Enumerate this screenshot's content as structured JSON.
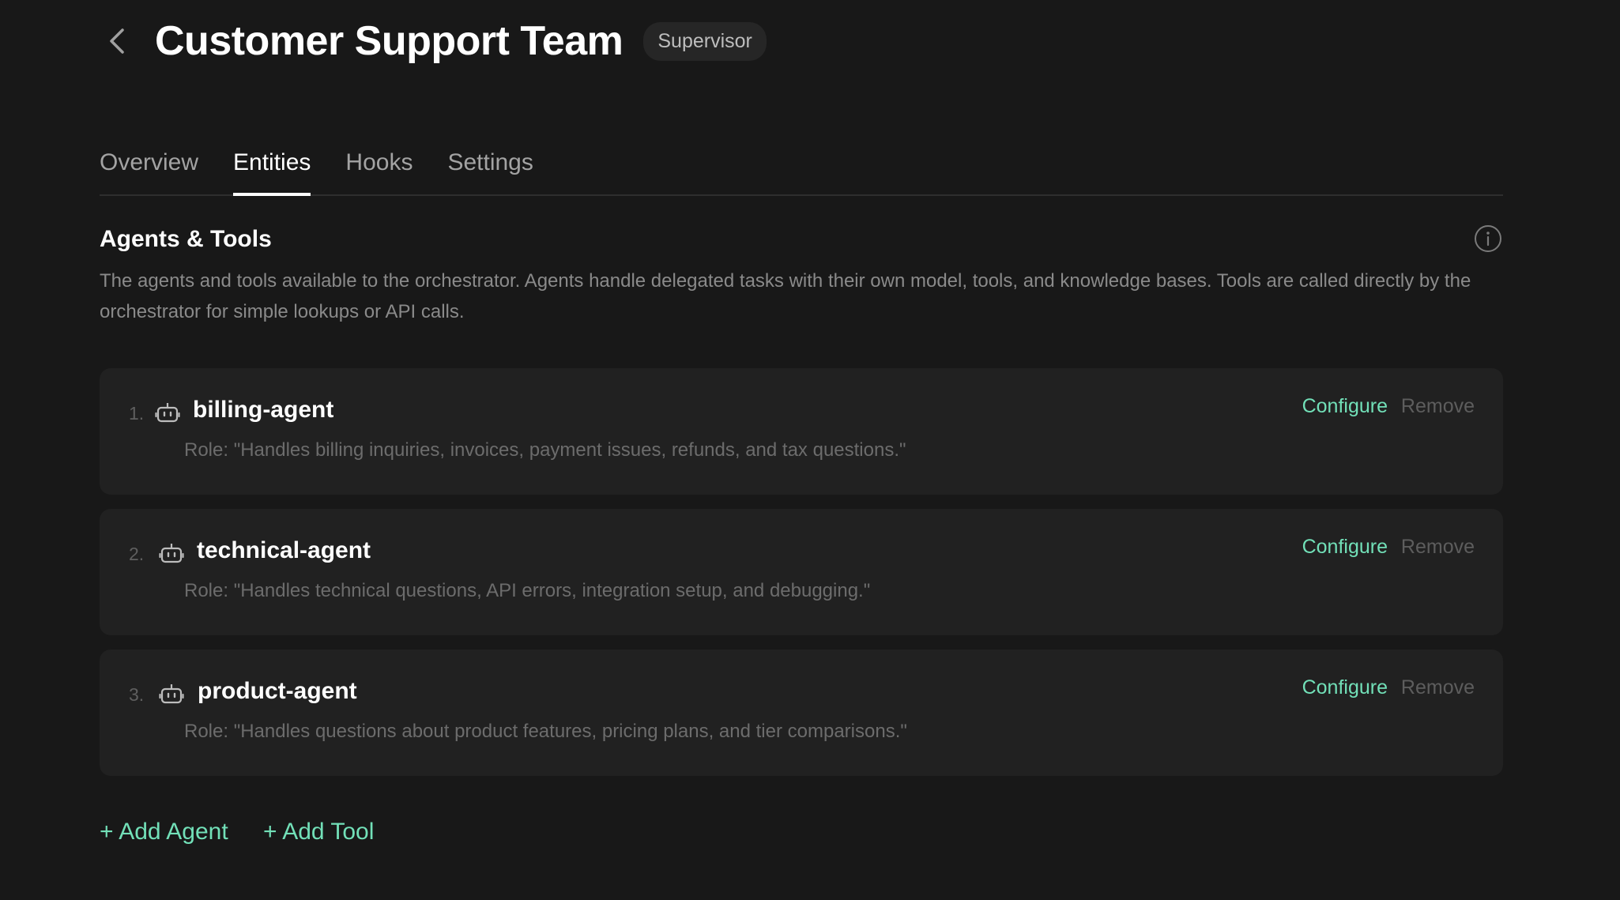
{
  "header": {
    "title": "Customer Support Team",
    "badge": "Supervisor"
  },
  "tabs": [
    {
      "label": "Overview",
      "active": false
    },
    {
      "label": "Entities",
      "active": true
    },
    {
      "label": "Hooks",
      "active": false
    },
    {
      "label": "Settings",
      "active": false
    }
  ],
  "section": {
    "title": "Agents & Tools",
    "description": "The agents and tools available to the orchestrator. Agents handle delegated tasks with their own model, tools, and knowledge bases. Tools are called directly by the orchestrator for simple lookups or API calls."
  },
  "agents": [
    {
      "number": "1.",
      "icon": "robot-icon",
      "name": "billing-agent",
      "role": "Role: \"Handles billing inquiries, invoices, payment issues, refunds, and tax questions.\"",
      "configure_label": "Configure",
      "remove_label": "Remove"
    },
    {
      "number": "2.",
      "icon": "robot-icon",
      "name": "technical-agent",
      "role": "Role: \"Handles technical questions, API errors, integration setup, and debugging.\"",
      "configure_label": "Configure",
      "remove_label": "Remove"
    },
    {
      "number": "3.",
      "icon": "robot-icon",
      "name": "product-agent",
      "role": "Role: \"Handles questions about product features, pricing plans, and tier comparisons.\"",
      "configure_label": "Configure",
      "remove_label": "Remove"
    }
  ],
  "actions": {
    "add_agent": "+ Add Agent",
    "add_tool": "+ Add Tool"
  },
  "colors": {
    "background": "#181818",
    "card": "#212121",
    "accent": "#72e0b8",
    "muted": "#8a8a8a"
  }
}
